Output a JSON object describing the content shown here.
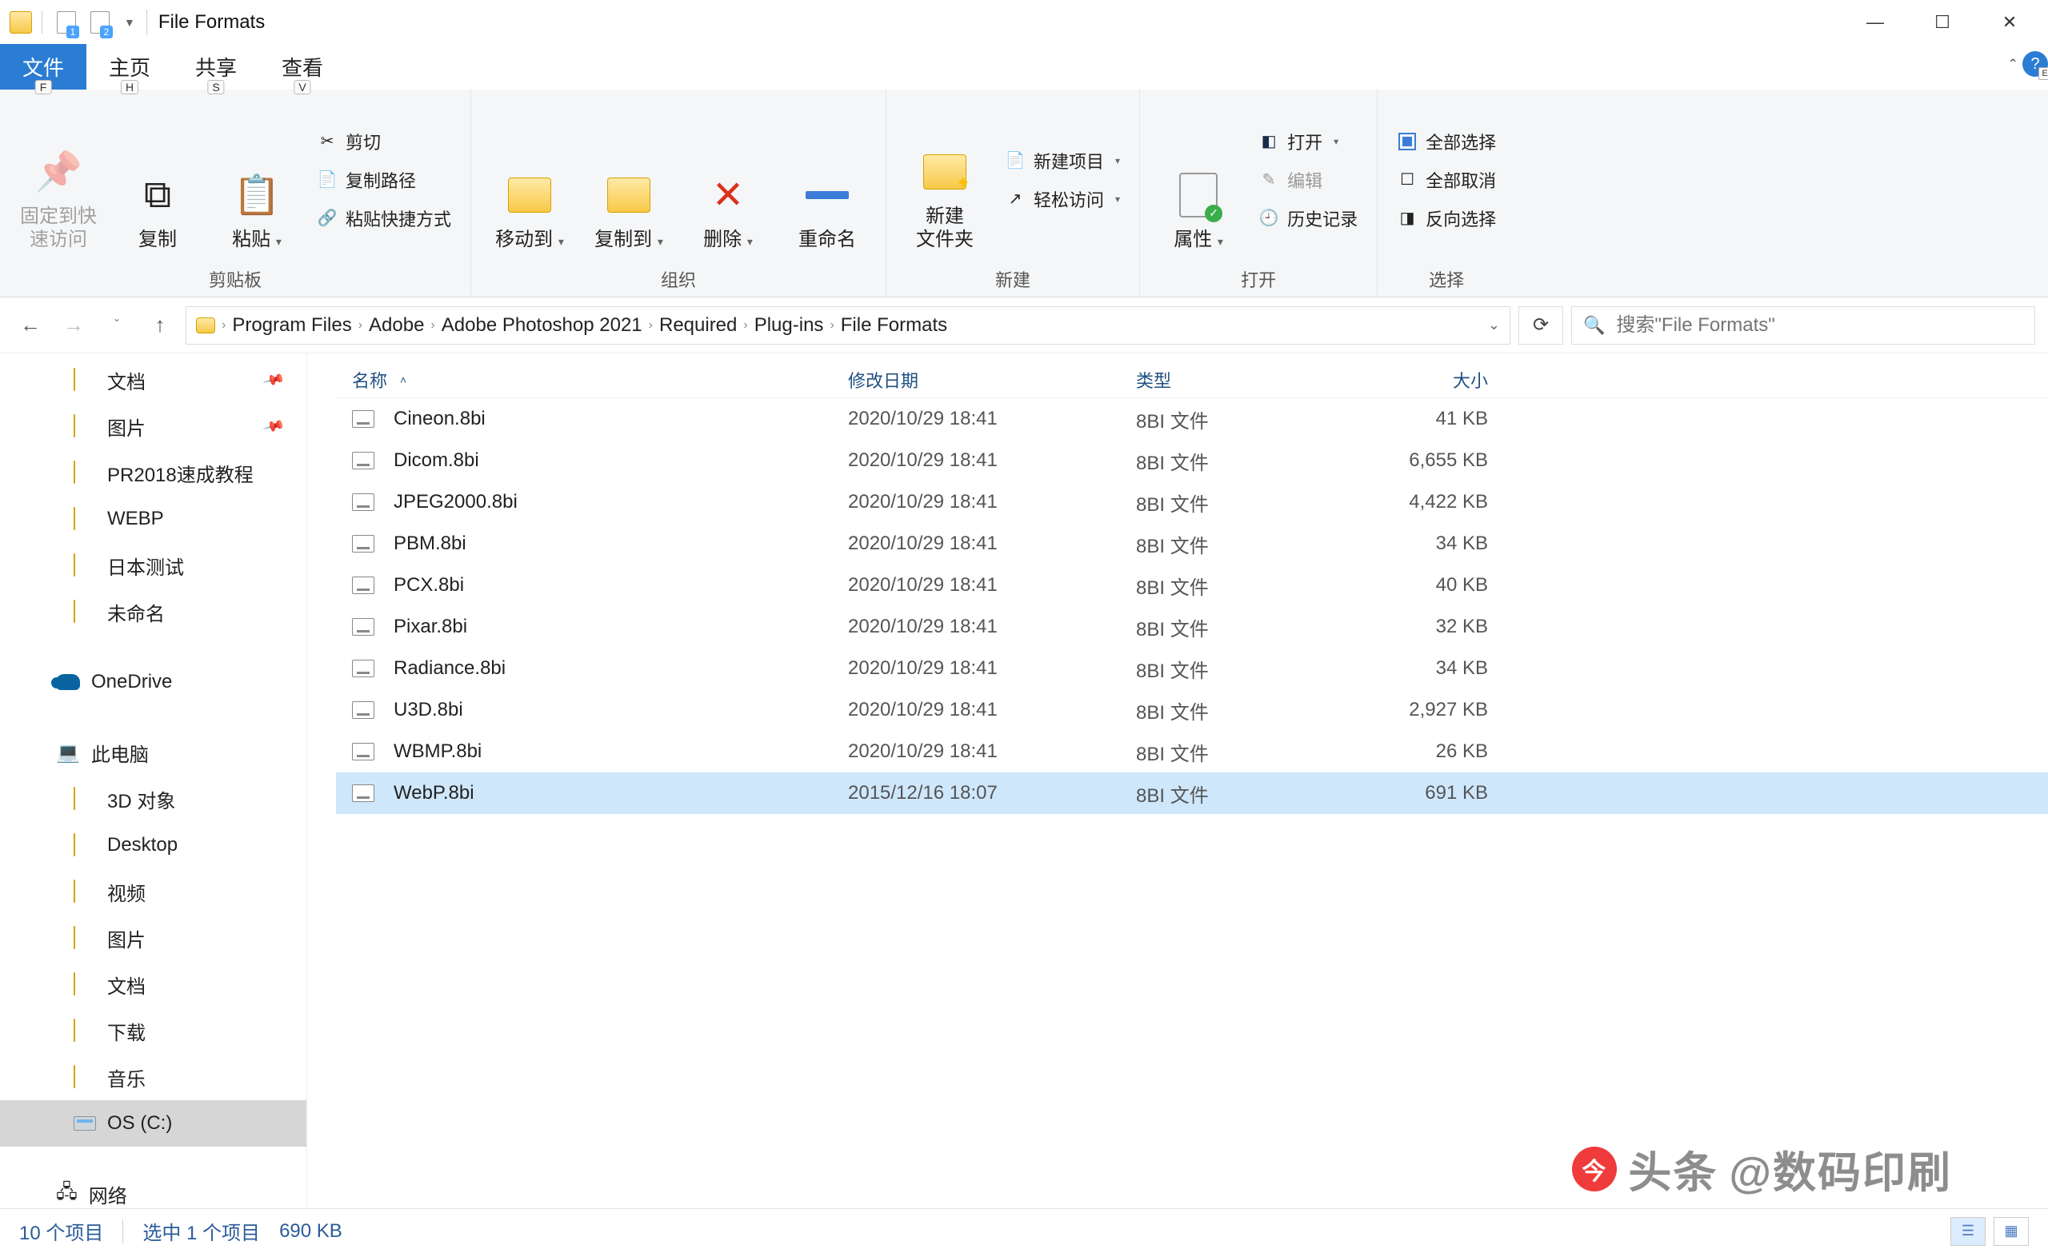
{
  "window": {
    "title": "File Formats",
    "qat_badges": [
      "1",
      "2"
    ]
  },
  "tabs": {
    "file": "文件",
    "home": "主页",
    "share": "共享",
    "view": "查看",
    "keys": {
      "file": "F",
      "home": "H",
      "share": "S",
      "view": "V"
    },
    "help_corner": "E"
  },
  "ribbon": {
    "clipboard": {
      "pin": "固定到快\n速访问",
      "copy": "复制",
      "paste": "粘贴",
      "cut": "剪切",
      "copy_path": "复制路径",
      "paste_shortcut": "粘贴快捷方式",
      "group": "剪贴板"
    },
    "organize": {
      "move_to": "移动到",
      "copy_to": "复制到",
      "delete": "删除",
      "rename": "重命名",
      "group": "组织"
    },
    "new": {
      "new_folder": "新建\n文件夹",
      "new_item": "新建项目",
      "easy_access": "轻松访问",
      "group": "新建"
    },
    "open": {
      "properties": "属性",
      "open": "打开",
      "edit": "编辑",
      "history": "历史记录",
      "group": "打开"
    },
    "select": {
      "select_all": "全部选择",
      "select_none": "全部取消",
      "invert": "反向选择",
      "group": "选择"
    }
  },
  "breadcrumb": [
    "Program Files",
    "Adobe",
    "Adobe Photoshop 2021",
    "Required",
    "Plug-ins",
    "File Formats"
  ],
  "search": {
    "placeholder": "搜索\"File Formats\""
  },
  "sidebar": {
    "quick": [
      {
        "label": "文档",
        "pinned": true
      },
      {
        "label": "图片",
        "pinned": true
      },
      {
        "label": "PR2018速成教程",
        "pinned": false
      },
      {
        "label": "WEBP",
        "pinned": false
      },
      {
        "label": "日本测试",
        "pinned": false
      },
      {
        "label": "未命名",
        "pinned": false
      }
    ],
    "onedrive": "OneDrive",
    "this_pc": "此电脑",
    "pc_children": [
      "3D 对象",
      "Desktop",
      "视频",
      "图片",
      "文档",
      "下载",
      "音乐"
    ],
    "drive": "OS (C:)",
    "network": "网络"
  },
  "columns": {
    "name": "名称",
    "date": "修改日期",
    "type": "类型",
    "size": "大小"
  },
  "files": [
    {
      "name": "Cineon.8bi",
      "date": "2020/10/29 18:41",
      "type": "8BI 文件",
      "size": "41 KB"
    },
    {
      "name": "Dicom.8bi",
      "date": "2020/10/29 18:41",
      "type": "8BI 文件",
      "size": "6,655 KB"
    },
    {
      "name": "JPEG2000.8bi",
      "date": "2020/10/29 18:41",
      "type": "8BI 文件",
      "size": "4,422 KB"
    },
    {
      "name": "PBM.8bi",
      "date": "2020/10/29 18:41",
      "type": "8BI 文件",
      "size": "34 KB"
    },
    {
      "name": "PCX.8bi",
      "date": "2020/10/29 18:41",
      "type": "8BI 文件",
      "size": "40 KB"
    },
    {
      "name": "Pixar.8bi",
      "date": "2020/10/29 18:41",
      "type": "8BI 文件",
      "size": "32 KB"
    },
    {
      "name": "Radiance.8bi",
      "date": "2020/10/29 18:41",
      "type": "8BI 文件",
      "size": "34 KB"
    },
    {
      "name": "U3D.8bi",
      "date": "2020/10/29 18:41",
      "type": "8BI 文件",
      "size": "2,927 KB"
    },
    {
      "name": "WBMP.8bi",
      "date": "2020/10/29 18:41",
      "type": "8BI 文件",
      "size": "26 KB"
    },
    {
      "name": "WebP.8bi",
      "date": "2015/12/16 18:07",
      "type": "8BI 文件",
      "size": "691 KB",
      "selected": true
    }
  ],
  "status": {
    "count": "10 个项目",
    "selection": "选中 1 个项目",
    "sel_size": "690 KB"
  },
  "watermark": {
    "prefix": "头条",
    "handle": "@数码印刷"
  }
}
